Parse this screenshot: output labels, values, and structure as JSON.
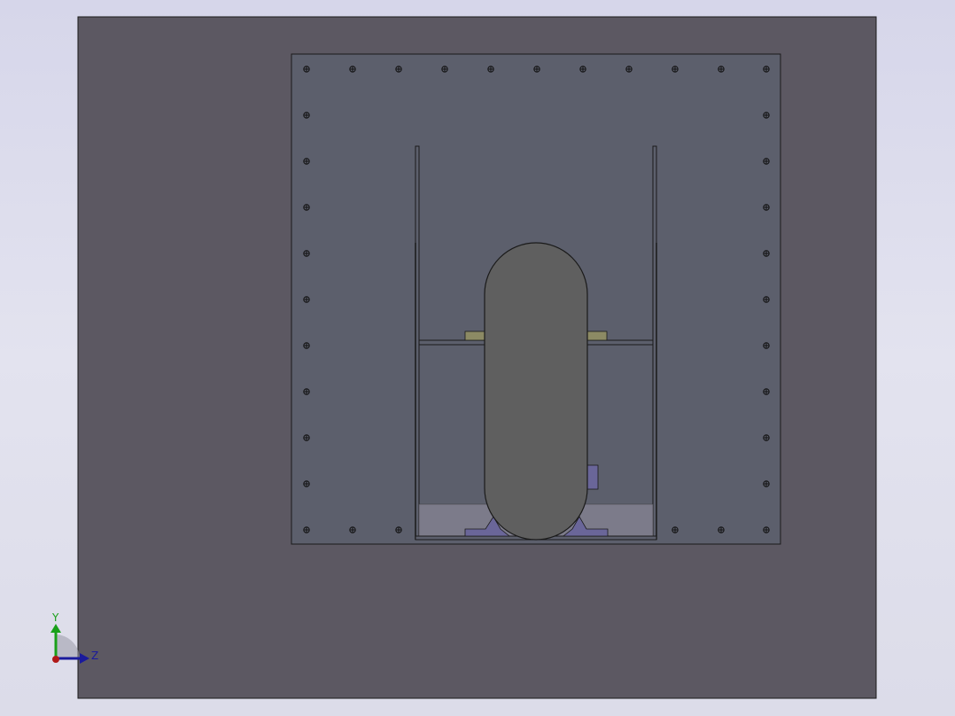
{
  "triad": {
    "y_label": "Y",
    "z_label": "Z"
  },
  "colors": {
    "background_top": "#d6d6ea",
    "base_plate": "#5c5862",
    "panel": "#5c5f6c",
    "tank": "#5f5f5f",
    "frame_line": "#1a1a1a",
    "pad": "#8c8a64",
    "saddle": "#6a6699",
    "floor": "#7c7b8a",
    "axis_y": "#19a019",
    "axis_z": "#1a1a9c",
    "axis_x": "#b01818"
  }
}
